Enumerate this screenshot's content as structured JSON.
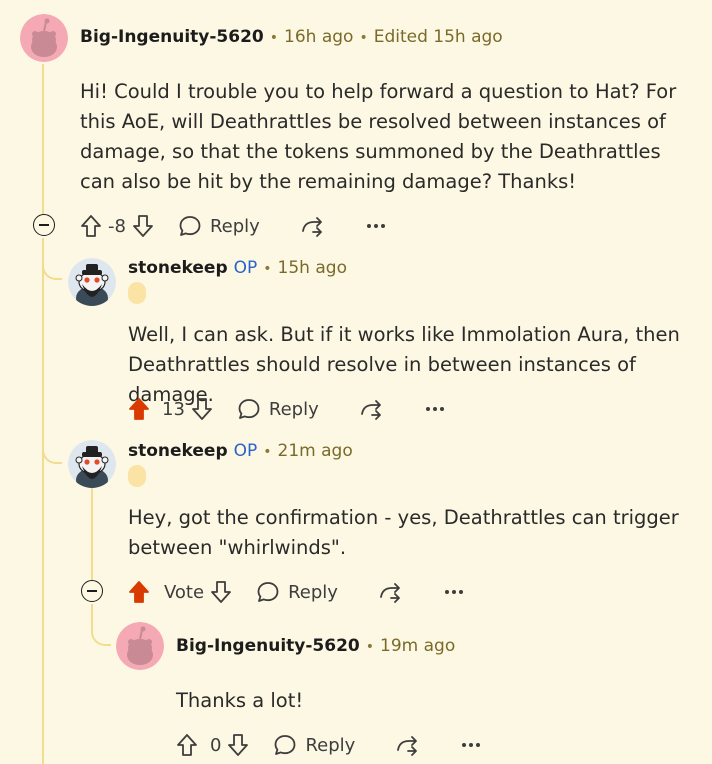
{
  "comments": [
    {
      "username": "Big-Ingenuity-5620",
      "time": "16h ago",
      "edited": "Edited 15h ago",
      "body": "Hi! Could I trouble you to help forward a question to Hat? For this AoE, will Deathrattles be resolved between instances of damage, so that the tokens summoned by the Deathrattles can also be hit by the remaining damage? Thanks!",
      "score": "-8",
      "reply_label": "Reply"
    },
    {
      "username": "stonekeep",
      "op_badge": "OP",
      "time": "15h ago",
      "body": "Well, I can ask. But if it works like Immolation Aura, then Deathrattles should resolve in between instances of damage.",
      "score": "13",
      "reply_label": "Reply"
    },
    {
      "username": "stonekeep",
      "op_badge": "OP",
      "time": "21m ago",
      "body": "Hey, got the confirmation - yes, Deathrattles can trigger between \"whirlwinds\".",
      "score": "Vote",
      "reply_label": "Reply"
    },
    {
      "username": "Big-Ingenuity-5620",
      "time": "19m ago",
      "body": "Thanks a lot!",
      "score": "0",
      "reply_label": "Reply"
    }
  ],
  "colors": {
    "background": "#fdf8e3",
    "thread_line": "#f2dc8f",
    "upvote_active": "#d93a00",
    "op_badge": "#2a64c9"
  },
  "icons": [
    "snoo-avatar-icon",
    "upvote-icon",
    "downvote-icon",
    "reply-icon",
    "share-icon",
    "more-icon",
    "collapse-icon"
  ]
}
